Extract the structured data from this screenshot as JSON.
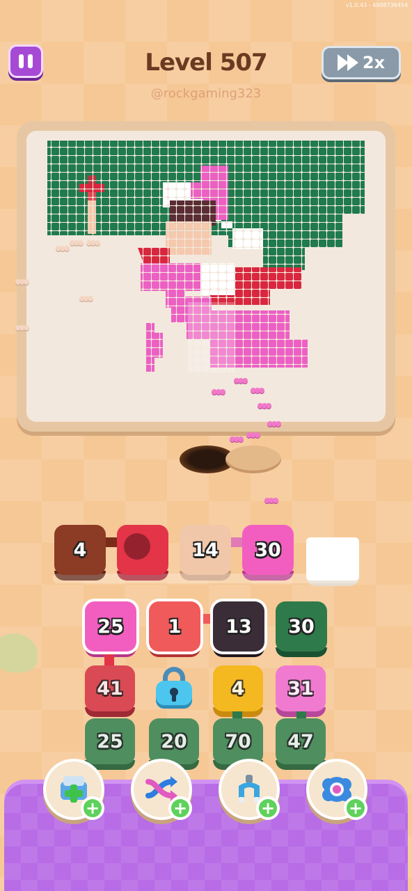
{
  "version": "v1.0.43 - 4908736454",
  "level_title": "Level 507",
  "watermark": "@rockgaming323",
  "speed_label": "2x",
  "queue_slots": [
    {
      "value": "4",
      "color": "brown"
    },
    {
      "value": "",
      "color": "red"
    },
    {
      "value": "14",
      "color": "beige"
    },
    {
      "value": "30",
      "color": "pink"
    },
    {
      "value": "",
      "color": "empty"
    }
  ],
  "grid": {
    "row1": [
      {
        "value": "25",
        "color": "pink"
      },
      {
        "value": "1",
        "color": "salmon"
      },
      {
        "value": "13",
        "color": "dark"
      },
      {
        "value": "30",
        "color": "green"
      }
    ],
    "row2": [
      {
        "value": "41",
        "color": "red"
      },
      {
        "value": "",
        "color": "locked"
      },
      {
        "value": "4",
        "color": "yellow"
      },
      {
        "value": "31",
        "color": "pink"
      }
    ],
    "row3": [
      {
        "value": "25",
        "color": "green"
      },
      {
        "value": "20",
        "color": "green"
      },
      {
        "value": "70",
        "color": "green"
      },
      {
        "value": "47",
        "color": "green"
      }
    ]
  },
  "boosters": [
    {
      "icon": "add-slot-box-icon"
    },
    {
      "icon": "shuffle-arrows-icon"
    },
    {
      "icon": "magnet-claw-icon"
    },
    {
      "icon": "flower-bomb-icon"
    }
  ],
  "colors": {
    "pink": "#f25ec0",
    "red": "#e33448",
    "green": "#2f7a4a",
    "brown": "#8c3b25",
    "beige": "#f0c7a8",
    "purple_panel": "#b86ce6"
  }
}
